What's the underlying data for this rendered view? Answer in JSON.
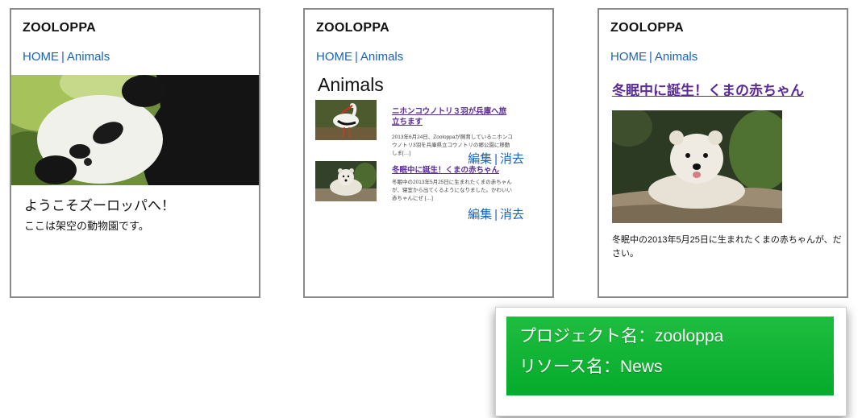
{
  "mockups": [
    {
      "site_title": "ZOOLOPPA",
      "nav": {
        "home": "HOME",
        "separator": "|",
        "animals": "Animals"
      },
      "image": "panda-photo",
      "welcome_title": "ようこそズーロッパへ！",
      "welcome_text": "ここは架空の動物園です。"
    },
    {
      "site_title": "ZOOLOPPA",
      "nav": {
        "home": "HOME",
        "separator": "|",
        "animals": "Animals"
      },
      "heading": "Animals",
      "entries": [
        {
          "image": "stork-photo",
          "title": "ニホンコウノトリ３羽が兵庫へ旅立ちます",
          "excerpt": "2013年6月24日、Zooloppaが飼育しているニホンコウノトリ3羽を兵庫県立コウノトリの郷公園に移動しま[…]",
          "edit": "編集",
          "separator": "|",
          "delete": "消去"
        },
        {
          "image": "polar-bear-cub-photo",
          "title": "冬眠中に誕生！くまの赤ちゃん",
          "excerpt": "冬眠中の2013年5月25日に生まれたくまの赤ちゃんが、寝室から出てくるようになりました。かわいい赤ちゃんにぜ […]",
          "edit": "編集",
          "separator": "|",
          "delete": "消去"
        }
      ]
    },
    {
      "site_title": "ZOOLOPPA",
      "nav": {
        "home": "HOME",
        "separator": "|",
        "animals": "Animals"
      },
      "title": "冬眠中に誕生！くまの赤ちゃん",
      "image": "polar-bear-cub-photo",
      "body": "冬眠中の2013年5月25日に生まれたくまの赤ちゃんが、ださい。"
    }
  ],
  "note": {
    "project_line": "プロジェクト名：zooloppa",
    "resource_line": "リソース名：News"
  },
  "colors": {
    "link": "#1a63b8",
    "visited_link": "#5a2a96",
    "note_green": "#0db333"
  }
}
